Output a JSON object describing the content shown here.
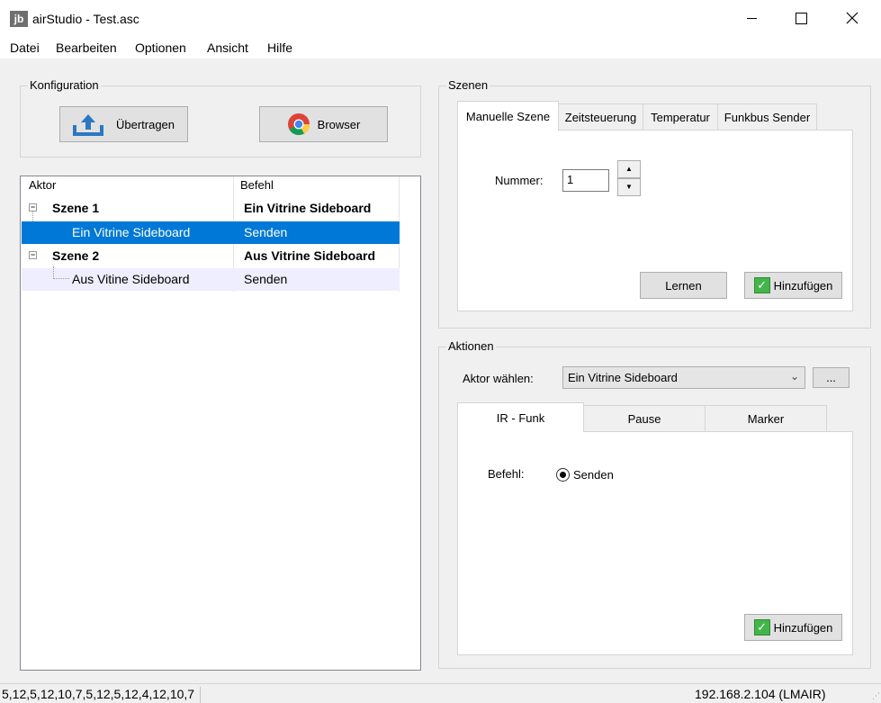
{
  "window": {
    "icon_text": "jb",
    "title": "airStudio - Test.asc"
  },
  "menu": [
    "Datei",
    "Bearbeiten",
    "Optionen",
    "Ansicht",
    "Hilfe"
  ],
  "konfiguration": {
    "label": "Konfiguration",
    "upload_button": "Übertragen",
    "browser_button": "Browser"
  },
  "tree": {
    "headers": [
      "Aktor",
      "Befehl"
    ],
    "rows": [
      {
        "aktor": "Szene 1",
        "befehl": "Ein Vitrine Sideboard"
      },
      {
        "aktor": "Ein Vitrine Sideboard",
        "befehl": "Senden"
      },
      {
        "aktor": "Szene 2",
        "befehl": "Aus Vitrine Sideboard"
      },
      {
        "aktor": "Aus Vitine Sideboard",
        "befehl": "Senden"
      }
    ],
    "expander_symbol": "−"
  },
  "szenen": {
    "label": "Szenen",
    "tabs": [
      "Manuelle Szene",
      "Zeitsteuerung",
      "Temperatur",
      "Funkbus Sender"
    ],
    "nummer_label": "Nummer:",
    "nummer_value": "1",
    "spin_up": "▲",
    "spin_down": "▼",
    "lernen_button": "Lernen",
    "hinzufuegen_button": "Hinzufügen"
  },
  "aktionen": {
    "label": "Aktionen",
    "aktor_label": "Aktor wählen:",
    "aktor_value": "Ein Vitrine Sideboard",
    "more_button": "...",
    "tabs": [
      "IR - Funk",
      "Pause",
      "Marker"
    ],
    "befehl_label": "Befehl:",
    "befehl_option": "Senden",
    "hinzufuegen_button": "Hinzufügen"
  },
  "status": {
    "left": "5,12,5,12,10,7,5,12,5,12,4,12,10,7",
    "right": "192.168.2.104 (LMAIR)"
  },
  "icons": {
    "checkmark": "✓",
    "combo_arrow": "⌄"
  }
}
